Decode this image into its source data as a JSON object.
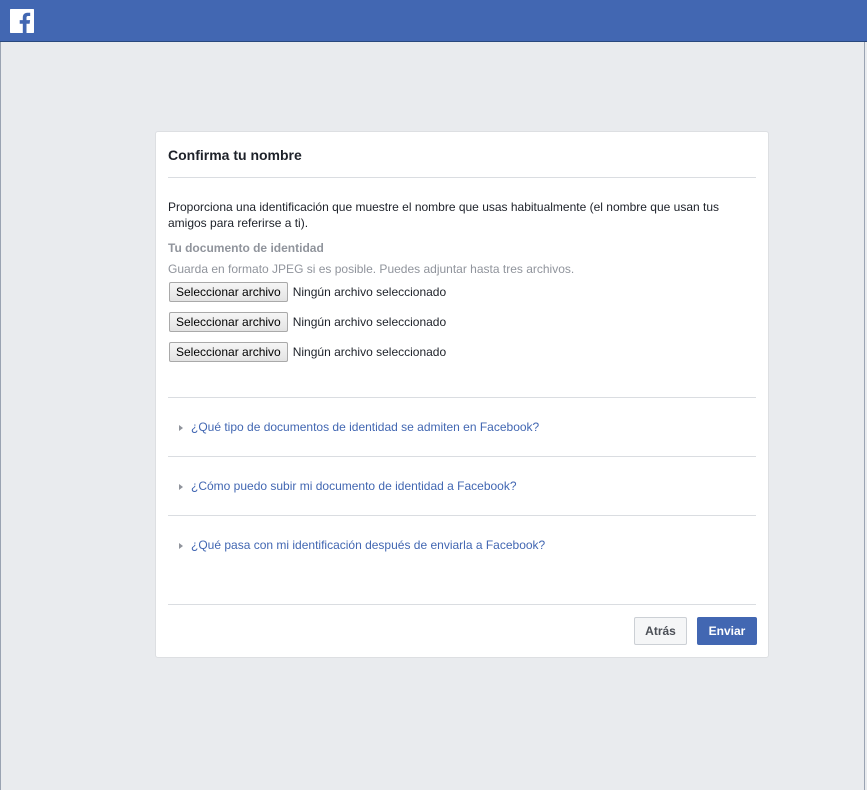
{
  "header": {
    "logo_icon": "facebook-logo-icon",
    "brand_color": "#4267b2"
  },
  "card": {
    "title": "Confirma tu nombre",
    "intro": "Proporciona una identificación que muestre el nombre que usas habitualmente (el nombre que usan tus amigos para referirse a ti).",
    "doc_label": "Tu documento de identidad",
    "doc_hint": "Guarda en formato JPEG si es posible. Puedes adjuntar hasta tres archivos.",
    "file_inputs": [
      {
        "button_label": "Seleccionar archivo",
        "status": "Ningún archivo seleccionado"
      },
      {
        "button_label": "Seleccionar archivo",
        "status": "Ningún archivo seleccionado"
      },
      {
        "button_label": "Seleccionar archivo",
        "status": "Ningún archivo seleccionado"
      }
    ],
    "faqs": [
      {
        "question": "¿Qué tipo de documentos de identidad se admiten en Facebook?"
      },
      {
        "question": "¿Cómo puedo subir mi documento de identidad a Facebook?"
      },
      {
        "question": "¿Qué pasa con mi identificación después de enviarla a Facebook?"
      }
    ],
    "buttons": {
      "back_label": "Atrás",
      "submit_label": "Enviar"
    }
  }
}
